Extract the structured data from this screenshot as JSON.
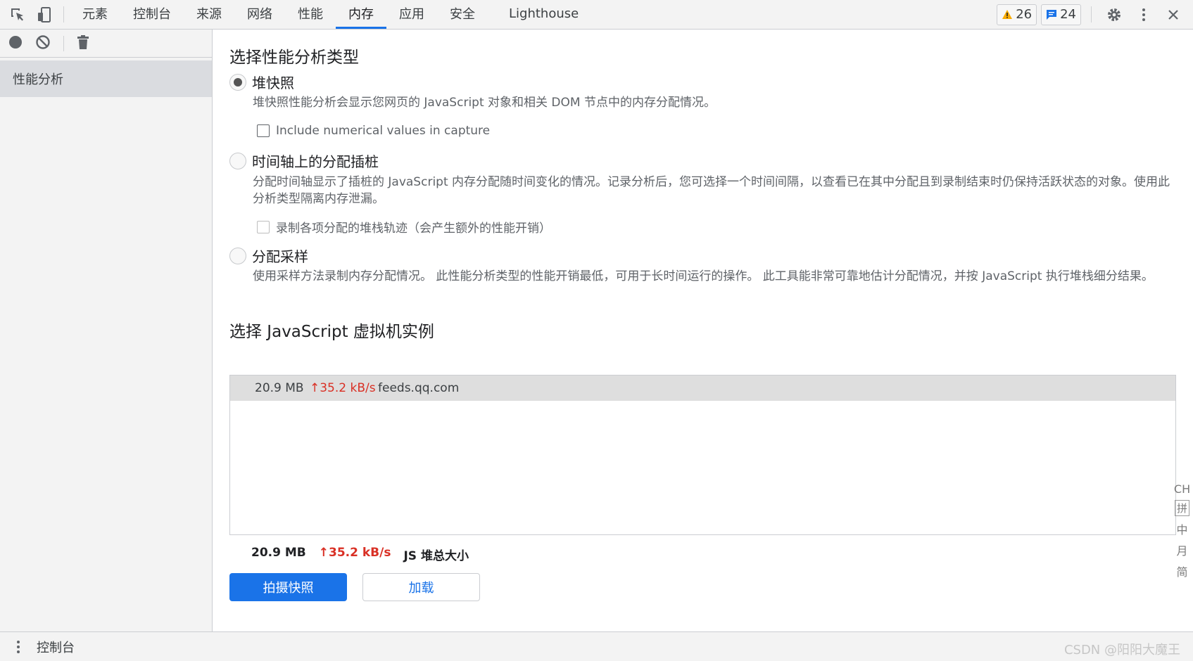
{
  "topbar": {
    "tabs": [
      {
        "label": "元素",
        "active": false
      },
      {
        "label": "控制台",
        "active": false
      },
      {
        "label": "来源",
        "active": false
      },
      {
        "label": "网络",
        "active": false
      },
      {
        "label": "性能",
        "active": false
      },
      {
        "label": "内存",
        "active": true
      },
      {
        "label": "应用",
        "active": false
      },
      {
        "label": "安全",
        "active": false
      },
      {
        "label": "Lighthouse",
        "active": false
      }
    ],
    "warnings_count": "26",
    "messages_count": "24",
    "icons": [
      "inspect-element-icon",
      "device-toggle-icon",
      "warning-icon",
      "message-icon",
      "gear-icon",
      "more-vertical-icon",
      "close-icon"
    ],
    "colors": {
      "accent": "#1a73e8",
      "warning": "#f9ab00",
      "error": "#d93025"
    }
  },
  "sidebar": {
    "toolbar_icons": [
      "record-icon",
      "clear-icon",
      "trash-icon"
    ],
    "items": [
      {
        "label": "性能分析"
      }
    ]
  },
  "main": {
    "heading_profile_type": "选择性能分析类型",
    "options": [
      {
        "label": "堆快照",
        "selected": true,
        "description": "堆快照性能分析会显示您网页的 JavaScript 对象和相关 DOM 节点中的内存分配情况。",
        "checkbox": {
          "label": "Include numerical values in capture",
          "checked": false,
          "disabled": false
        }
      },
      {
        "label": "时间轴上的分配插桩",
        "selected": false,
        "description": "分配时间轴显示了插桩的 JavaScript 内存分配随时间变化的情况。记录分析后，您可选择一个时间间隔，以查看已在其中分配且到录制结束时仍保持活跃状态的对象。使用此分析类型隔离内存泄漏。",
        "checkbox": {
          "label": "录制各项分配的堆栈轨迹（会产生额外的性能开销）",
          "checked": false,
          "disabled": true
        }
      },
      {
        "label": "分配采样",
        "selected": false,
        "description": "使用采样方法录制内存分配情况。 此性能分析类型的性能开销最低，可用于长时间运行的操作。 此工具能非常可靠地估计分配情况，并按 JavaScript 执行堆栈细分结果。"
      }
    ],
    "heading_vm": "选择 JavaScript 虚拟机实例",
    "vm_instances": [
      {
        "size": "20.9 MB",
        "rate": "↑35.2 kB/s",
        "host": "feeds.qq.com"
      }
    ],
    "summary": {
      "size": "20.9 MB",
      "rate": "↑35.2 kB/s",
      "label": "JS 堆总大小"
    },
    "buttons": {
      "primary": "拍摄快照",
      "secondary": "加载"
    }
  },
  "bottombar": {
    "label": "控制台"
  },
  "watermark": "CSDN @阳阳大魔王",
  "ime": {
    "items": [
      "CH",
      "拼",
      "中",
      "月",
      "简"
    ]
  }
}
